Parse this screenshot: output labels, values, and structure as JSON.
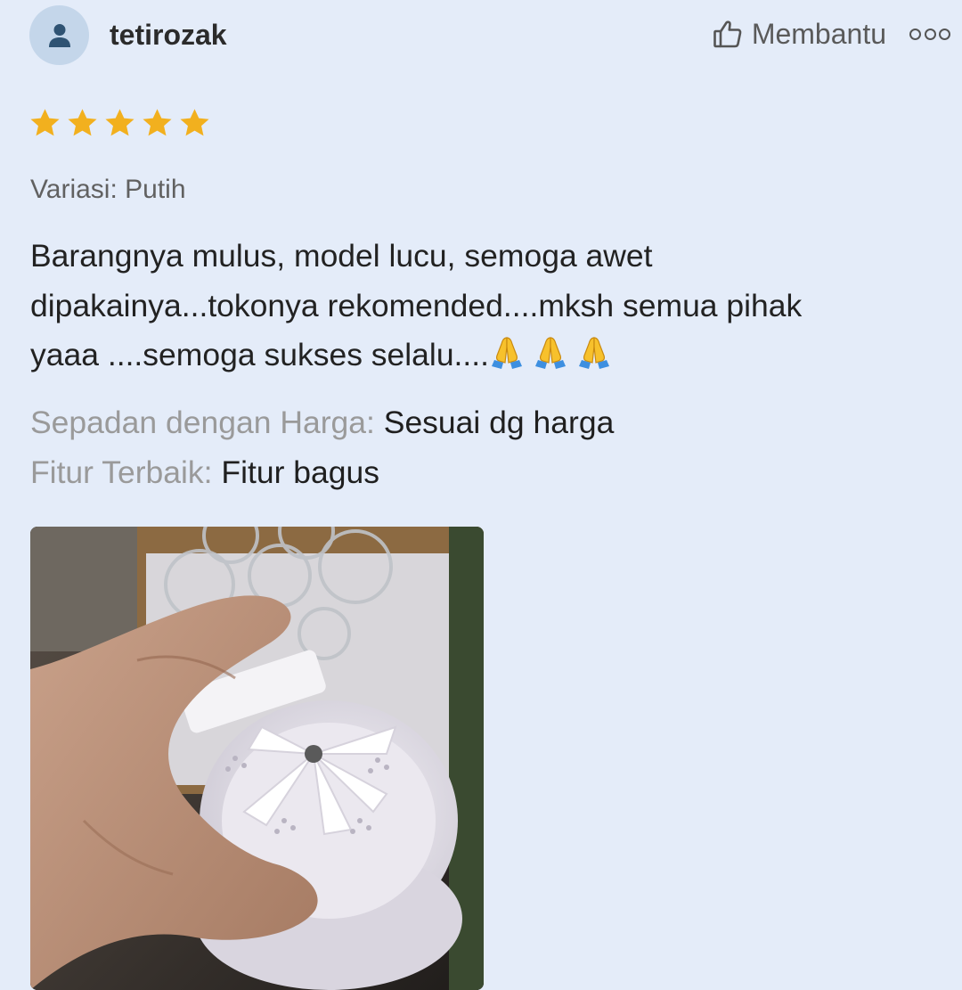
{
  "reviewer": {
    "name": "tetirozak",
    "avatar_icon": "person-icon"
  },
  "actions": {
    "helpful_label": "Membantu",
    "helpful_icon": "thumbs-up-icon",
    "more_icon": "more-options-icon"
  },
  "rating": {
    "value": 5,
    "max": 5,
    "star_color": "#f2b01e"
  },
  "variation": "Variasi: Putih",
  "review_text": {
    "line1": "Barangnya mulus, model lucu, semoga awet",
    "line2": "dipakainya...tokonya rekomended....mksh semua pihak",
    "line3": "yaaa ....semoga sukses selalu...."
  },
  "emoji": {
    "name": "folded-hands-icon",
    "count": 3
  },
  "attributes": [
    {
      "label": "Sepadan dengan Harga:",
      "value": "Sesuai dg harga"
    },
    {
      "label": "Fitur Terbaik:",
      "value": "Fitur bagus"
    }
  ],
  "colors": {
    "background": "#e4ecf9",
    "avatar_bg": "#c4d6ea",
    "avatar_fg": "#2f5373",
    "label_gray": "#9a9a9a"
  }
}
